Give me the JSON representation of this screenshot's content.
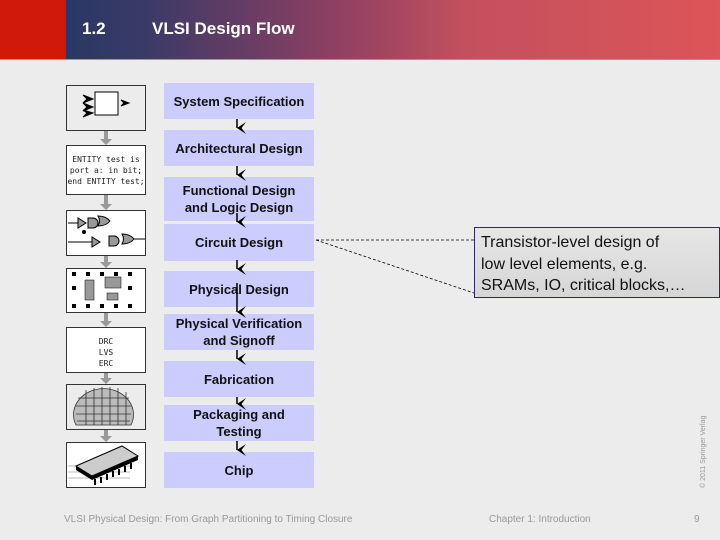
{
  "header": {
    "section_number": "1.2",
    "title": "VLSI Design Flow"
  },
  "flow_steps": [
    {
      "label": "System Specification"
    },
    {
      "label": "Architectural Design"
    },
    {
      "label": "Functional Design\nand Logic Design"
    },
    {
      "label": "Circuit Design"
    },
    {
      "label": "Physical Design"
    },
    {
      "label": "Physical Verification\nand Signoff"
    },
    {
      "label": "Fabrication"
    },
    {
      "label": "Packaging and\nTesting"
    },
    {
      "label": "Chip"
    }
  ],
  "side_icons": {
    "hdl_code": "ENTITY test is\nport a: in bit;\nend ENTITY test;",
    "verification_checks": [
      "DRC",
      "LVS",
      "ERC"
    ]
  },
  "callout": {
    "text": "Transistor-level design of\nlow level elements, e.g.\nSRAMs, IO, critical blocks,…",
    "attached_to": "Circuit Design"
  },
  "copyright": "© 2011 Springer Verlag",
  "footer": {
    "book_title": "VLSI Physical Design: From Graph Partitioning to Timing Closure",
    "chapter": "Chapter 1: Introduction",
    "page_number": "9"
  }
}
